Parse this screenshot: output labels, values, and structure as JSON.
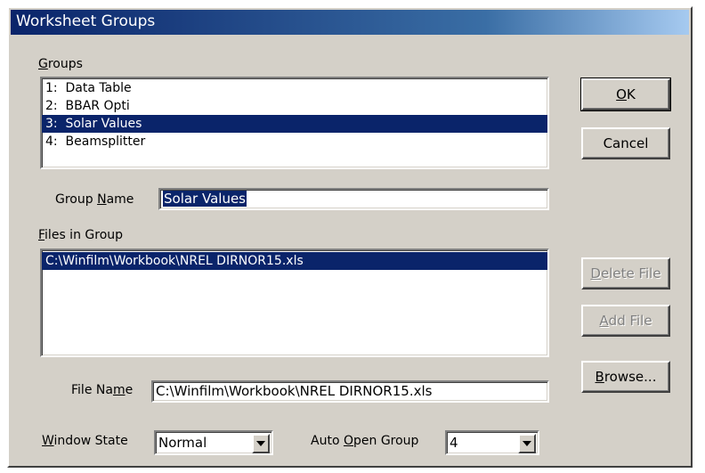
{
  "window": {
    "title": "Worksheet Groups"
  },
  "groups": {
    "label_prefix": "",
    "label_ul": "G",
    "label_rest": "roups",
    "items": [
      "1:  Data Table",
      "2:  BBAR Opti",
      "3:  Solar Values",
      "4:  Beamsplitter"
    ],
    "selected_index": 2
  },
  "group_name": {
    "label_pre": "Group ",
    "label_ul": "N",
    "label_post": "ame",
    "value": "Solar Values"
  },
  "files": {
    "label_ul": "F",
    "label_rest": "iles in Group",
    "items": [
      "C:\\Winfilm\\Workbook\\NREL DIRNOR15.xls"
    ],
    "selected_index": 0
  },
  "file_name": {
    "label_pre": "File Na",
    "label_ul": "m",
    "label_post": "e",
    "value": "C:\\Winfilm\\Workbook\\NREL DIRNOR15.xls"
  },
  "window_state": {
    "label_ul": "W",
    "label_rest": "indow State",
    "value": "Normal"
  },
  "auto_open": {
    "label_pre": "Auto ",
    "label_ul": "O",
    "label_post": "pen Group",
    "value": "4"
  },
  "buttons": {
    "ok": {
      "ul": "O",
      "rest": "K"
    },
    "cancel": {
      "label": "Cancel"
    },
    "delete_file": {
      "ul": "D",
      "rest": "elete File",
      "enabled": false
    },
    "add_file": {
      "ul": "A",
      "rest": "dd File",
      "enabled": false
    },
    "browse": {
      "ul": "B",
      "rest": "rowse..."
    }
  },
  "colors": {
    "dialog_bg": "#d4d0c8",
    "selection": "#0a246a",
    "title_start": "#0a246a",
    "title_end": "#a6caf0"
  }
}
